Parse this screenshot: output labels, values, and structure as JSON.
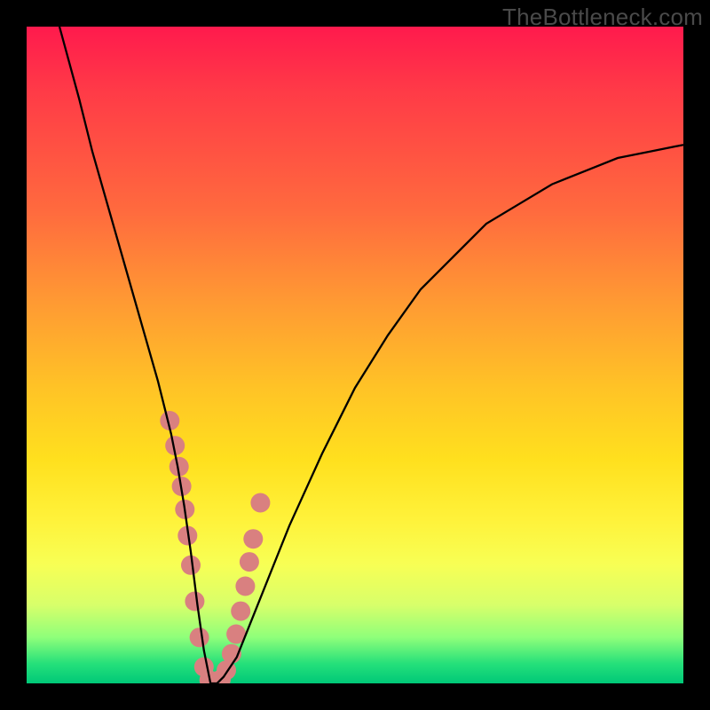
{
  "watermark": "TheBottleneck.com",
  "chart_data": {
    "type": "line",
    "title": "",
    "xlabel": "",
    "ylabel": "",
    "xlim": [
      0,
      100
    ],
    "ylim": [
      0,
      100
    ],
    "grid": false,
    "legend": false,
    "series": [
      {
        "name": "bottleneck-curve",
        "x": [
          5,
          8,
          10,
          12,
          14,
          16,
          18,
          20,
          22,
          23,
          24,
          25,
          26,
          27,
          28,
          29,
          30,
          32,
          34,
          36,
          40,
          45,
          50,
          55,
          60,
          65,
          70,
          75,
          80,
          85,
          90,
          95,
          100
        ],
        "values": [
          100,
          89,
          81,
          74,
          67,
          60,
          53,
          46,
          38,
          33,
          27,
          20,
          12,
          5,
          0,
          0,
          1,
          4,
          9,
          14,
          24,
          35,
          45,
          53,
          60,
          65,
          70,
          73,
          76,
          78,
          80,
          81,
          82
        ]
      }
    ],
    "markers": {
      "name": "highlight-dots",
      "color": "#d98080",
      "radius": 11,
      "x": [
        21.8,
        22.6,
        23.2,
        23.6,
        24.1,
        24.5,
        25.0,
        25.6,
        26.3,
        27.0,
        27.8,
        28.6,
        29.6,
        30.4,
        31.2,
        31.9,
        32.6,
        33.3,
        33.9,
        34.5,
        35.6
      ],
      "values": [
        40.0,
        36.2,
        33.0,
        30.0,
        26.5,
        22.5,
        18.0,
        12.5,
        7.0,
        2.5,
        0.5,
        0.3,
        0.6,
        2.0,
        4.5,
        7.5,
        11.0,
        14.8,
        18.5,
        22.0,
        27.5
      ]
    }
  }
}
